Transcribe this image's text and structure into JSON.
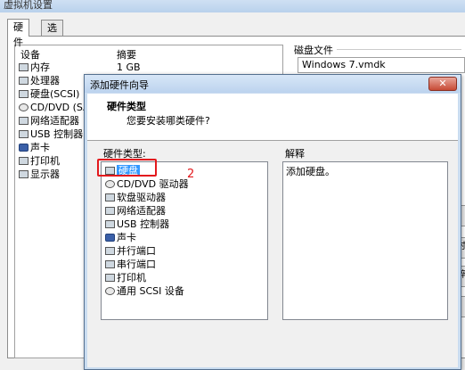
{
  "background_window": {
    "title": "虚拟机设置",
    "tabs": [
      {
        "label": "硬件",
        "active": true
      },
      {
        "label": "选项",
        "active": false
      }
    ],
    "device_list": {
      "headers": [
        "设备",
        "摘要"
      ],
      "rows": [
        {
          "icon": "memory-icon",
          "label": "内存",
          "summary": "1 GB"
        },
        {
          "icon": "processor-icon",
          "label": "处理器",
          "summary": "1"
        },
        {
          "icon": "hard-disk-icon",
          "label": "硬盘(SCSI)",
          "summary": ""
        },
        {
          "icon": "cd-dvd-icon",
          "label": "CD/DVD (SA",
          "summary": ""
        },
        {
          "icon": "network-adapter-icon",
          "label": "网络适配器",
          "summary": ""
        },
        {
          "icon": "usb-icon",
          "label": "USB 控制器",
          "summary": ""
        },
        {
          "icon": "sound-card-icon",
          "label": "声卡",
          "summary": ""
        },
        {
          "icon": "printer-icon",
          "label": "打印机",
          "summary": ""
        },
        {
          "icon": "display-icon",
          "label": "显示器",
          "summary": ""
        }
      ]
    },
    "disk_file": {
      "label": "磁盘文件",
      "value": "Windows 7.vmdk"
    },
    "side_buttons": [
      "",
      "时",
      "碎",
      ""
    ]
  },
  "wizard": {
    "title": "添加硬件向导",
    "close_symbol": "✕",
    "heading": "硬件类型",
    "subheading": "您要安装哪类硬件?",
    "hardware_types_label": "硬件类型:",
    "hardware_types": [
      {
        "icon": "hard-disk-icon",
        "label": "硬盘",
        "selected": true
      },
      {
        "icon": "cd-dvd-icon",
        "label": "CD/DVD 驱动器",
        "selected": false
      },
      {
        "icon": "floppy-icon",
        "label": "软盘驱动器",
        "selected": false
      },
      {
        "icon": "network-adapter-icon",
        "label": "网络适配器",
        "selected": false
      },
      {
        "icon": "usb-icon",
        "label": "USB 控制器",
        "selected": false
      },
      {
        "icon": "sound-card-icon",
        "label": "声卡",
        "selected": false
      },
      {
        "icon": "parallel-port-icon",
        "label": "并行端口",
        "selected": false
      },
      {
        "icon": "serial-port-icon",
        "label": "串行端口",
        "selected": false
      },
      {
        "icon": "printer-icon",
        "label": "打印机",
        "selected": false
      },
      {
        "icon": "scsi-device-icon",
        "label": "通用 SCSI 设备",
        "selected": false
      }
    ],
    "explanation_label": "解释",
    "explanation_text": "添加硬盘。",
    "annotation_number": "2",
    "annotation_color": "#e3191d",
    "selection_color": "#3399ff"
  }
}
